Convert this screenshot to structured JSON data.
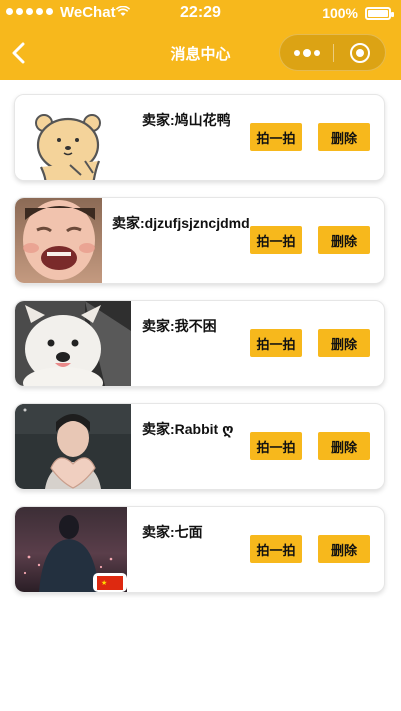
{
  "status_bar": {
    "carrier": "WeChat",
    "time": "22:29",
    "battery": "100%"
  },
  "nav": {
    "title": "消息中心",
    "back_icon": "chevron-left-icon",
    "more_icon": "more-dots-icon",
    "close_icon": "target-close-icon"
  },
  "colors": {
    "accent": "#F7B81C",
    "card_border": "#e6e6e6",
    "text": "#111111"
  },
  "messages": [
    {
      "seller": "卖家:鸠山花鸭",
      "avatar": "cartoon-bear-avatar",
      "pat_label": "拍一拍",
      "delete_label": "删除"
    },
    {
      "seller": "卖家:djzufjsjzncjdmd",
      "avatar": "crying-baby-avatar",
      "pat_label": "拍一拍",
      "delete_label": "删除"
    },
    {
      "seller": "卖家:我不困",
      "avatar": "white-puppy-avatar",
      "pat_label": "拍一拍",
      "delete_label": "删除"
    },
    {
      "seller": "卖家:Rabbit ღ",
      "avatar": "heart-hands-avatar",
      "pat_label": "拍一拍",
      "delete_label": "删除"
    },
    {
      "seller": "卖家:七面",
      "avatar": "night-silhouette-avatar",
      "pat_label": "拍一拍",
      "delete_label": "删除"
    }
  ]
}
